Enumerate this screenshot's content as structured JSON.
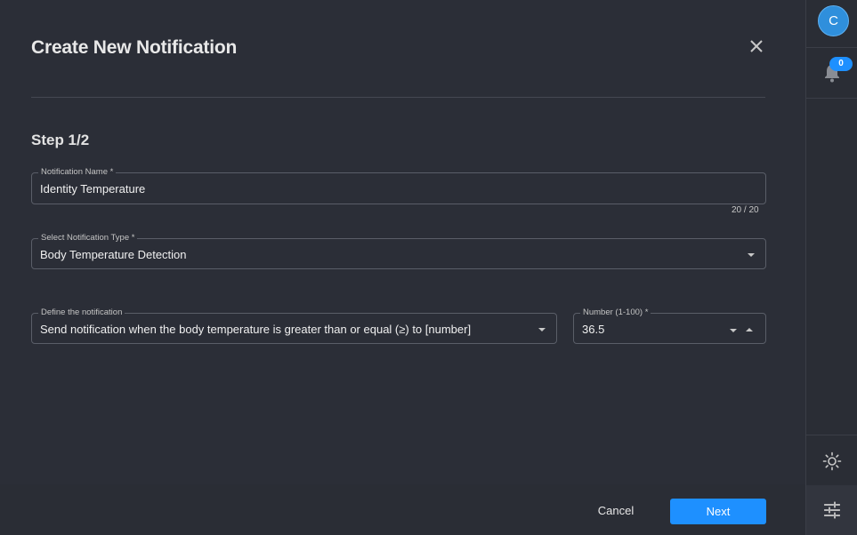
{
  "dialog": {
    "title": "Create New Notification",
    "step": "Step 1/2"
  },
  "fields": {
    "name": {
      "label": "Notification Name *",
      "value": "Identity Temperature",
      "counter": "20 / 20"
    },
    "type": {
      "label": "Select Notification Type *",
      "value": "Body Temperature Detection"
    },
    "define": {
      "label": "Define the notification",
      "value": "Send notification when the body temperature is greater than or equal (≥) to [number]"
    },
    "number": {
      "label": "Number (1-100) *",
      "value": "36.5"
    }
  },
  "footer": {
    "cancel_label": "Cancel",
    "next_label": "Next"
  },
  "rail": {
    "avatar_initial": "C",
    "notification_count": "0"
  },
  "colors": {
    "accent": "#1e90ff",
    "background": "#2b2e37"
  }
}
